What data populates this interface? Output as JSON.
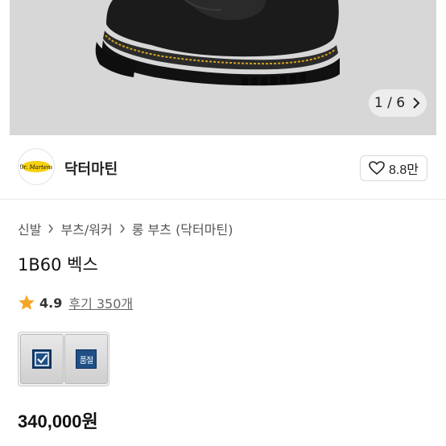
{
  "hero": {
    "counter_current": "1",
    "counter_sep": "/",
    "counter_total": "6"
  },
  "shop": {
    "name": "닥터마틴",
    "like_count": "8.8만",
    "logo_text": "Dr. Martens"
  },
  "breadcrumb": {
    "items": [
      "신발",
      "부츠/워커",
      "롱 부츠 (닥터마틴)"
    ]
  },
  "product": {
    "title": "1B60 벡스",
    "rating": "4.9",
    "reviews": "후기 350개",
    "price": "340,000원"
  },
  "options": {
    "soldout_label": "품절"
  },
  "colors": {
    "star": "#f5a623",
    "hero_bg": "#d7d7d7",
    "option_badge": "#1e4f86"
  }
}
